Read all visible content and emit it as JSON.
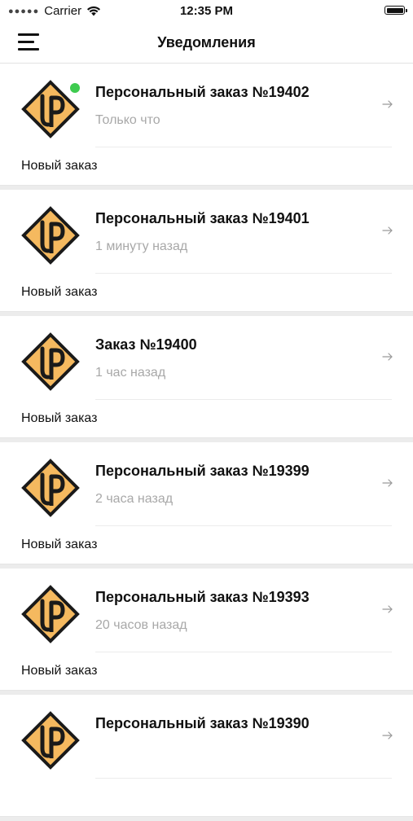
{
  "status_bar": {
    "carrier": "Carrier",
    "time": "12:35 PM"
  },
  "header": {
    "title": "Уведомления",
    "menu_icon": "hamburger-menu-icon"
  },
  "colors": {
    "logo_fill": "#f5b95f",
    "logo_border": "#1a1a1a",
    "online_dot": "#3ecb4f",
    "time_text": "#a8a8a8"
  },
  "notifications": [
    {
      "title": "Персональный заказ №19402",
      "time": "Только что",
      "message": "Новый заказ",
      "unread": true
    },
    {
      "title": "Персональный заказ №19401",
      "time": "1 минуту назад",
      "message": "Новый заказ",
      "unread": false
    },
    {
      "title": "Заказ №19400",
      "time": "1 час назад",
      "message": "Новый заказ",
      "unread": false
    },
    {
      "title": "Персональный заказ №19399",
      "time": "2 часа назад",
      "message": "Новый заказ",
      "unread": false
    },
    {
      "title": "Персональный заказ №19393",
      "time": "20 часов назад",
      "message": "Новый заказ",
      "unread": false
    },
    {
      "title": "Персональный заказ №19390",
      "time": "",
      "message": "",
      "unread": false
    }
  ]
}
